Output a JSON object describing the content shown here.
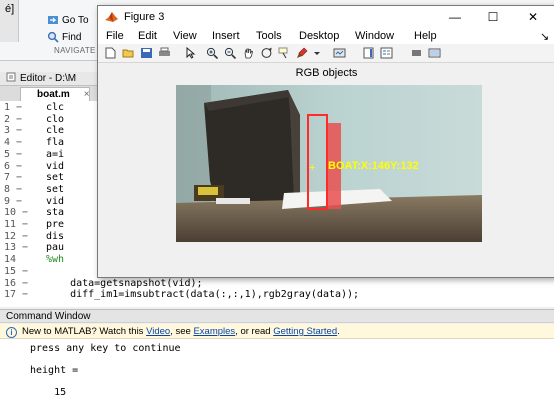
{
  "ribbon": {
    "left_stub": "é]",
    "goto_label": "Go To",
    "find_label": "Find",
    "nav_label": "NAVIGATE"
  },
  "editor": {
    "title": "Editor - D:\\M",
    "tab_label": "boat.m",
    "tab_close": "×",
    "lines": [
      {
        "n": "1 −",
        "t": "clc"
      },
      {
        "n": "2 −",
        "t": "clo"
      },
      {
        "n": "3 −",
        "t": "cle"
      },
      {
        "n": "4 −",
        "t": "fla"
      },
      {
        "n": "5 −",
        "t": "a=i"
      },
      {
        "n": "6 −",
        "t": "vid"
      },
      {
        "n": "7 −",
        "t": "set"
      },
      {
        "n": "8 −",
        "t": "set"
      },
      {
        "n": "9 −",
        "t": "vid"
      },
      {
        "n": "10 −",
        "t": "sta"
      },
      {
        "n": "11 −",
        "t": "pre"
      },
      {
        "n": "12 −",
        "t": "dis"
      },
      {
        "n": "13 −",
        "t": "pau"
      },
      {
        "n": "14",
        "t": "%wh",
        "comment": true
      },
      {
        "n": "15 −",
        "t": ""
      },
      {
        "n": "16 −",
        "t": "    data=getsnapshot(vid);"
      },
      {
        "n": "17 −",
        "t": "    diff_im1=imsubtract(data(:,:,1),rgb2gray(data));"
      }
    ]
  },
  "command_window": {
    "title": "Command Window",
    "banner_prefix": "New to MATLAB? Watch this ",
    "banner_video": "Video",
    "banner_sep1": ", see ",
    "banner_examples": "Examples",
    "banner_sep2": ", or read ",
    "banner_started": "Getting Started",
    "banner_end": ".",
    "lines": [
      "press any key to continue",
      "",
      "height =",
      "",
      "    15"
    ]
  },
  "figure": {
    "title": "Figure 3",
    "controls": {
      "minimize": "—",
      "maximize": "☐",
      "close": "✕"
    },
    "menu": [
      "File",
      "Edit",
      "View",
      "Insert",
      "Tools",
      "Desktop",
      "Window",
      "Help"
    ],
    "menu_more": "↘",
    "axes_title": "RGB objects",
    "overlay_marker": "+",
    "overlay_label": "BOAT:X:146Y:132",
    "colors": {
      "bbox": "#ff2a2a",
      "label": "#ffff00"
    },
    "toolbar_icons": [
      "new-figure-icon",
      "open-icon",
      "save-icon",
      "print-icon",
      "pointer-icon",
      "zoom-in-icon",
      "zoom-out-icon",
      "pan-icon",
      "rotate-icon",
      "data-cursor-icon",
      "brush-icon",
      "link-icon",
      "colorbar-icon",
      "legend-icon",
      "hide-plot-tools-icon",
      "show-plot-tools-icon"
    ]
  }
}
